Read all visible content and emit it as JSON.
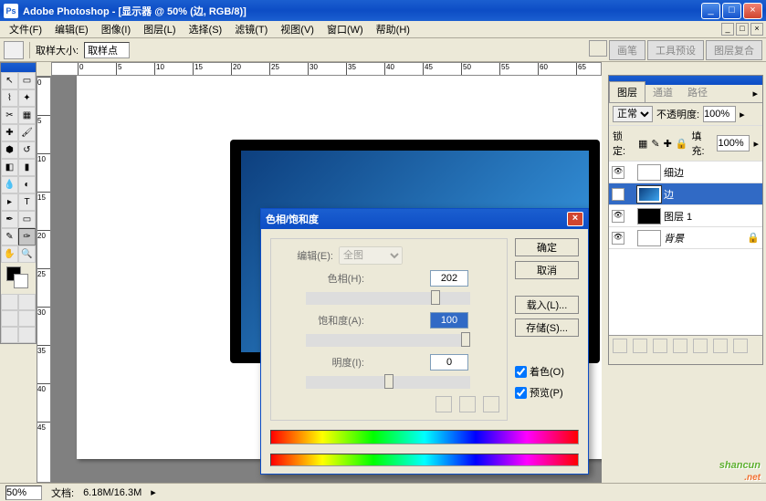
{
  "titlebar": {
    "app": "Adobe Photoshop",
    "doc": "[显示器 @ 50% (边, RGB/8)]"
  },
  "menu": [
    "文件(F)",
    "编辑(E)",
    "图像(I)",
    "图层(L)",
    "选择(S)",
    "滤镜(T)",
    "视图(V)",
    "窗口(W)",
    "帮助(H)"
  ],
  "optbar": {
    "label_size": "取样大小:",
    "value_point": "取样点",
    "tabs": [
      "画笔",
      "工具预设",
      "图层复合"
    ]
  },
  "ruler_h": [
    "0",
    "5",
    "10",
    "15",
    "20",
    "25",
    "30",
    "35",
    "40",
    "45",
    "50",
    "55",
    "60",
    "65"
  ],
  "ruler_v": [
    "0",
    "5",
    "10",
    "15",
    "20",
    "25",
    "30",
    "35",
    "40",
    "45"
  ],
  "layers": {
    "tabs": [
      "图层",
      "通道",
      "路径"
    ],
    "blend": "正常",
    "opacity_label": "不透明度:",
    "opacity": "100%",
    "lock_label": "锁定:",
    "fill_label": "填充:",
    "fill": "100%",
    "items": [
      {
        "name": "细边",
        "thumb": "white"
      },
      {
        "name": "边",
        "thumb": "blue",
        "selected": true
      },
      {
        "name": "图层 1",
        "thumb": "black"
      },
      {
        "name": "背景",
        "thumb": "bg",
        "locked": true
      }
    ]
  },
  "dialog": {
    "title": "色相/饱和度",
    "edit_label": "编辑(E):",
    "edit_value": "全图",
    "hue_label": "色相(H):",
    "hue": "202",
    "sat_label": "饱和度(A):",
    "sat": "100",
    "light_label": "明度(I):",
    "light": "0",
    "ok": "确定",
    "cancel": "取消",
    "load": "载入(L)...",
    "save": "存储(S)...",
    "colorize": "着色(O)",
    "preview": "预览(P)"
  },
  "status": {
    "zoom": "50%",
    "doc_label": "文档:",
    "doc_size": "6.18M/16.3M"
  },
  "watermark": {
    "main": "shancun",
    "sub": ".net"
  }
}
